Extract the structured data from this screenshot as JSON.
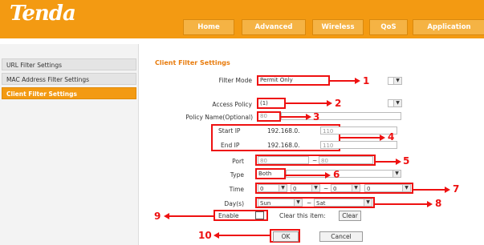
{
  "header": {
    "logo": "Tenda",
    "nav": [
      "Home",
      "Advanced",
      "Wireless",
      "QoS",
      "Application"
    ]
  },
  "sidebar": {
    "items": [
      {
        "label": "URL Filter Settings",
        "active": false
      },
      {
        "label": "MAC Address Filter Settings",
        "active": false
      },
      {
        "label": "Client Filter Settings",
        "active": true
      }
    ]
  },
  "main": {
    "title": "Client Filter Settings",
    "filter_mode": {
      "label": "Filter Mode",
      "value": "Permit Only"
    },
    "access_policy": {
      "label": "Access Policy",
      "value": "(1)"
    },
    "policy_name": {
      "label": "Policy Name(Optional)",
      "value": "80"
    },
    "start_ip": {
      "label": "Start IP",
      "prefix": "192.168.0.",
      "value": "110"
    },
    "end_ip": {
      "label": "End IP",
      "prefix": "192.168.0.",
      "value": "110"
    },
    "port": {
      "label": "Port",
      "from": "80",
      "sep": "~",
      "to": "80"
    },
    "type": {
      "label": "Type",
      "value": "Both"
    },
    "time": {
      "label": "Time",
      "h1": "0",
      "m1": "0",
      "sep": "~",
      "h2": "0",
      "m2": "0"
    },
    "days": {
      "label": "Day(s)",
      "from": "Sun",
      "sep": "~",
      "to": "Sat"
    },
    "enable": {
      "label": "Enable",
      "checked": false
    },
    "clear": {
      "label": "Clear this item:",
      "button": "Clear"
    },
    "buttons": {
      "ok": "OK",
      "cancel": "Cancel"
    }
  },
  "annotations": [
    "1",
    "2",
    "3",
    "4",
    "5",
    "6",
    "7",
    "8",
    "9",
    "10"
  ],
  "colors": {
    "brand": "#f39a12",
    "highlight": "#e11111",
    "title": "#e87b0c"
  }
}
